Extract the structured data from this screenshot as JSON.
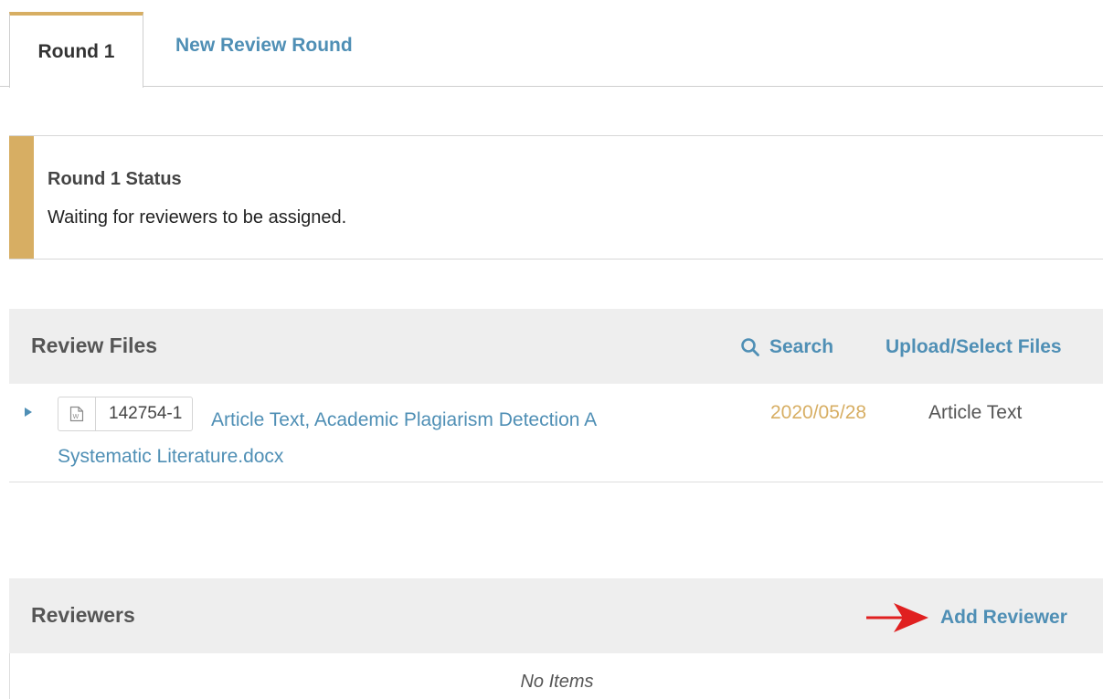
{
  "tabs": {
    "active_label": "Round 1",
    "new_round_label": "New Review Round"
  },
  "status": {
    "title": "Round 1 Status",
    "message": "Waiting for reviewers to be assigned."
  },
  "review_files": {
    "title": "Review Files",
    "search_label": "Search",
    "upload_label": "Upload/Select Files",
    "files": [
      {
        "id": "142754-1",
        "name": "Article Text, Academic Plagiarism Detection A Systematic Literature.docx",
        "date": "2020/05/28",
        "type": "Article Text",
        "icon": "word-document-icon"
      }
    ]
  },
  "reviewers": {
    "title": "Reviewers",
    "add_label": "Add Reviewer",
    "empty_text": "No Items"
  },
  "colors": {
    "accent": "#d7ae63",
    "link": "#4f8fb5",
    "annotation_arrow": "#e02020"
  }
}
